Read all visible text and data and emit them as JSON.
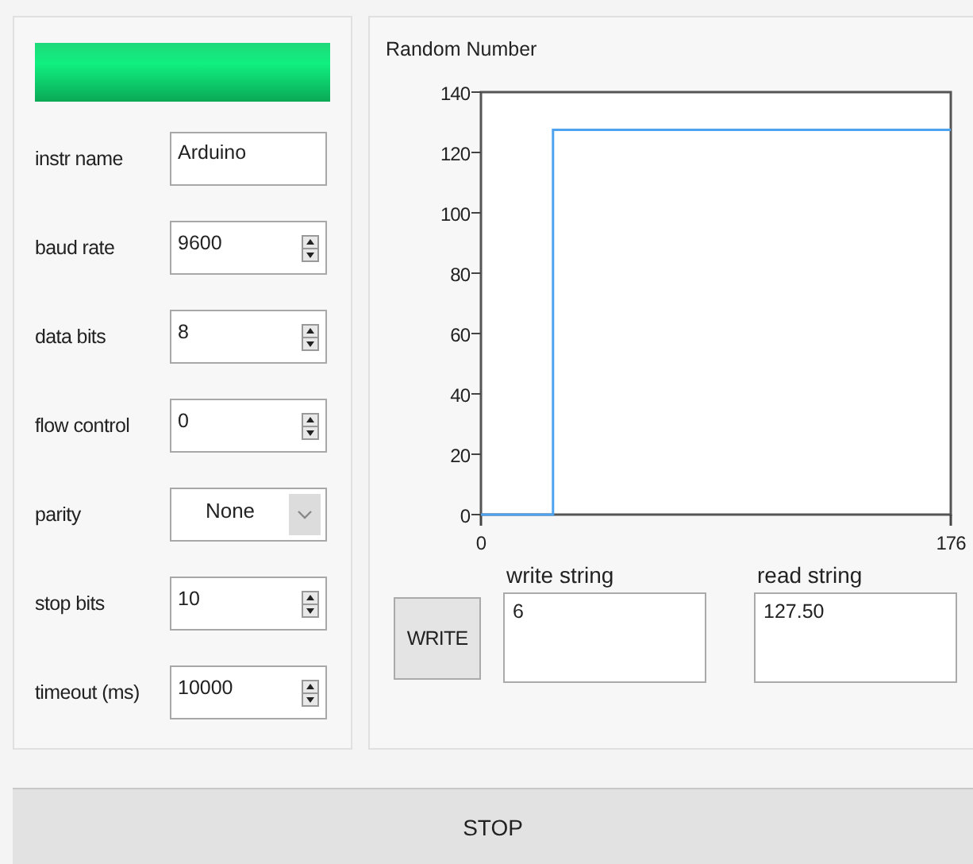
{
  "status_led": {
    "on": true
  },
  "settings": [
    {
      "kind": "text",
      "label": "instr name",
      "value": "Arduino"
    },
    {
      "kind": "numeric",
      "label": "baud rate",
      "value": "9600"
    },
    {
      "kind": "numeric",
      "label": "data bits",
      "value": "8"
    },
    {
      "kind": "numeric",
      "label": "flow control",
      "value": "0"
    },
    {
      "kind": "ring",
      "label": "parity",
      "value": "None"
    },
    {
      "kind": "numeric",
      "label": "stop bits",
      "value": "10"
    },
    {
      "kind": "numeric",
      "label": "timeout (ms)",
      "value": "10000"
    }
  ],
  "graph": {
    "title": "Random Number",
    "chart_data": {
      "type": "line",
      "x": [
        0,
        27,
        27,
        176
      ],
      "series": [
        {
          "color": "#4da3f0",
          "values": [
            0,
            0,
            127.5,
            127.5
          ]
        }
      ],
      "xlim": [
        0,
        176
      ],
      "ylim": [
        0,
        140
      ],
      "xticks": [
        0,
        176
      ],
      "yticks": [
        0,
        20,
        40,
        60,
        80,
        100,
        120,
        140
      ]
    }
  },
  "write_button": {
    "label": "WRITE"
  },
  "write_string": {
    "label": "write string",
    "value": "6"
  },
  "read_string": {
    "label": "read string",
    "value": "127.50"
  },
  "stop_button": {
    "label": "STOP"
  }
}
